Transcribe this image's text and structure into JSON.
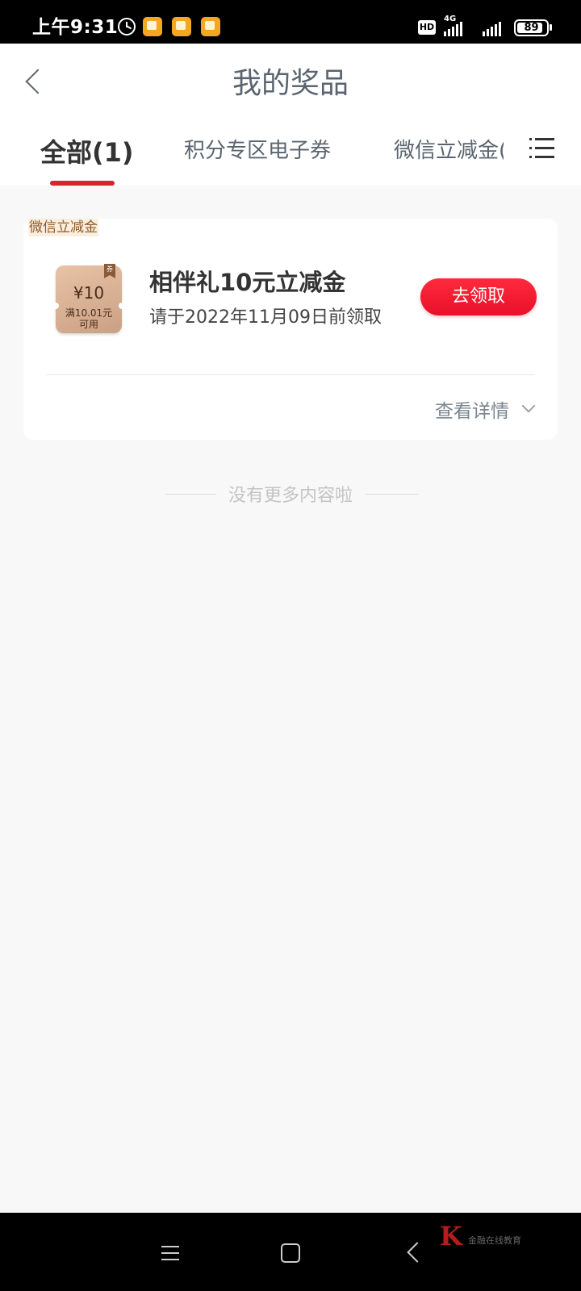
{
  "status_bar": {
    "time": "上午9:31",
    "hd_label": "HD",
    "network_label": "4G",
    "battery_level": 89,
    "battery_text": "89",
    "icons": [
      "alarm-icon",
      "notification-icon",
      "notification-icon",
      "notification-icon",
      "hd-icon",
      "signal-icon",
      "signal-icon",
      "battery-icon"
    ]
  },
  "header": {
    "back_icon": "chevron-left-icon",
    "title": "我的奖品"
  },
  "tabs": [
    {
      "label": "全部(1)",
      "active": true
    },
    {
      "label": "积分专区电子券",
      "active": false
    },
    {
      "label": "微信立减金(",
      "active": false
    }
  ],
  "menu_icon": "list-menu-icon",
  "prizes": [
    {
      "tag": "微信立减金",
      "coupon": {
        "badge": "券",
        "value": "¥10",
        "condition_line1": "满10.01元",
        "condition_line2": "可用"
      },
      "title": "相伴礼10元立减金",
      "deadline": "请于2022年11月09日前领取",
      "action_label": "去领取",
      "details_label": "查看详情"
    }
  ],
  "end_of_list": "没有更多内容啦",
  "nav_bar": {
    "icons": [
      "menu-icon",
      "home-icon",
      "back-icon"
    ]
  },
  "watermark": {
    "logo": "K",
    "text": "金融在线教育"
  },
  "colors": {
    "accent": "#d9232e",
    "button": "#ff2a3c",
    "title_text": "#5a6570",
    "tag_text": "#8b5a2b",
    "coupon": "#d9b093"
  }
}
